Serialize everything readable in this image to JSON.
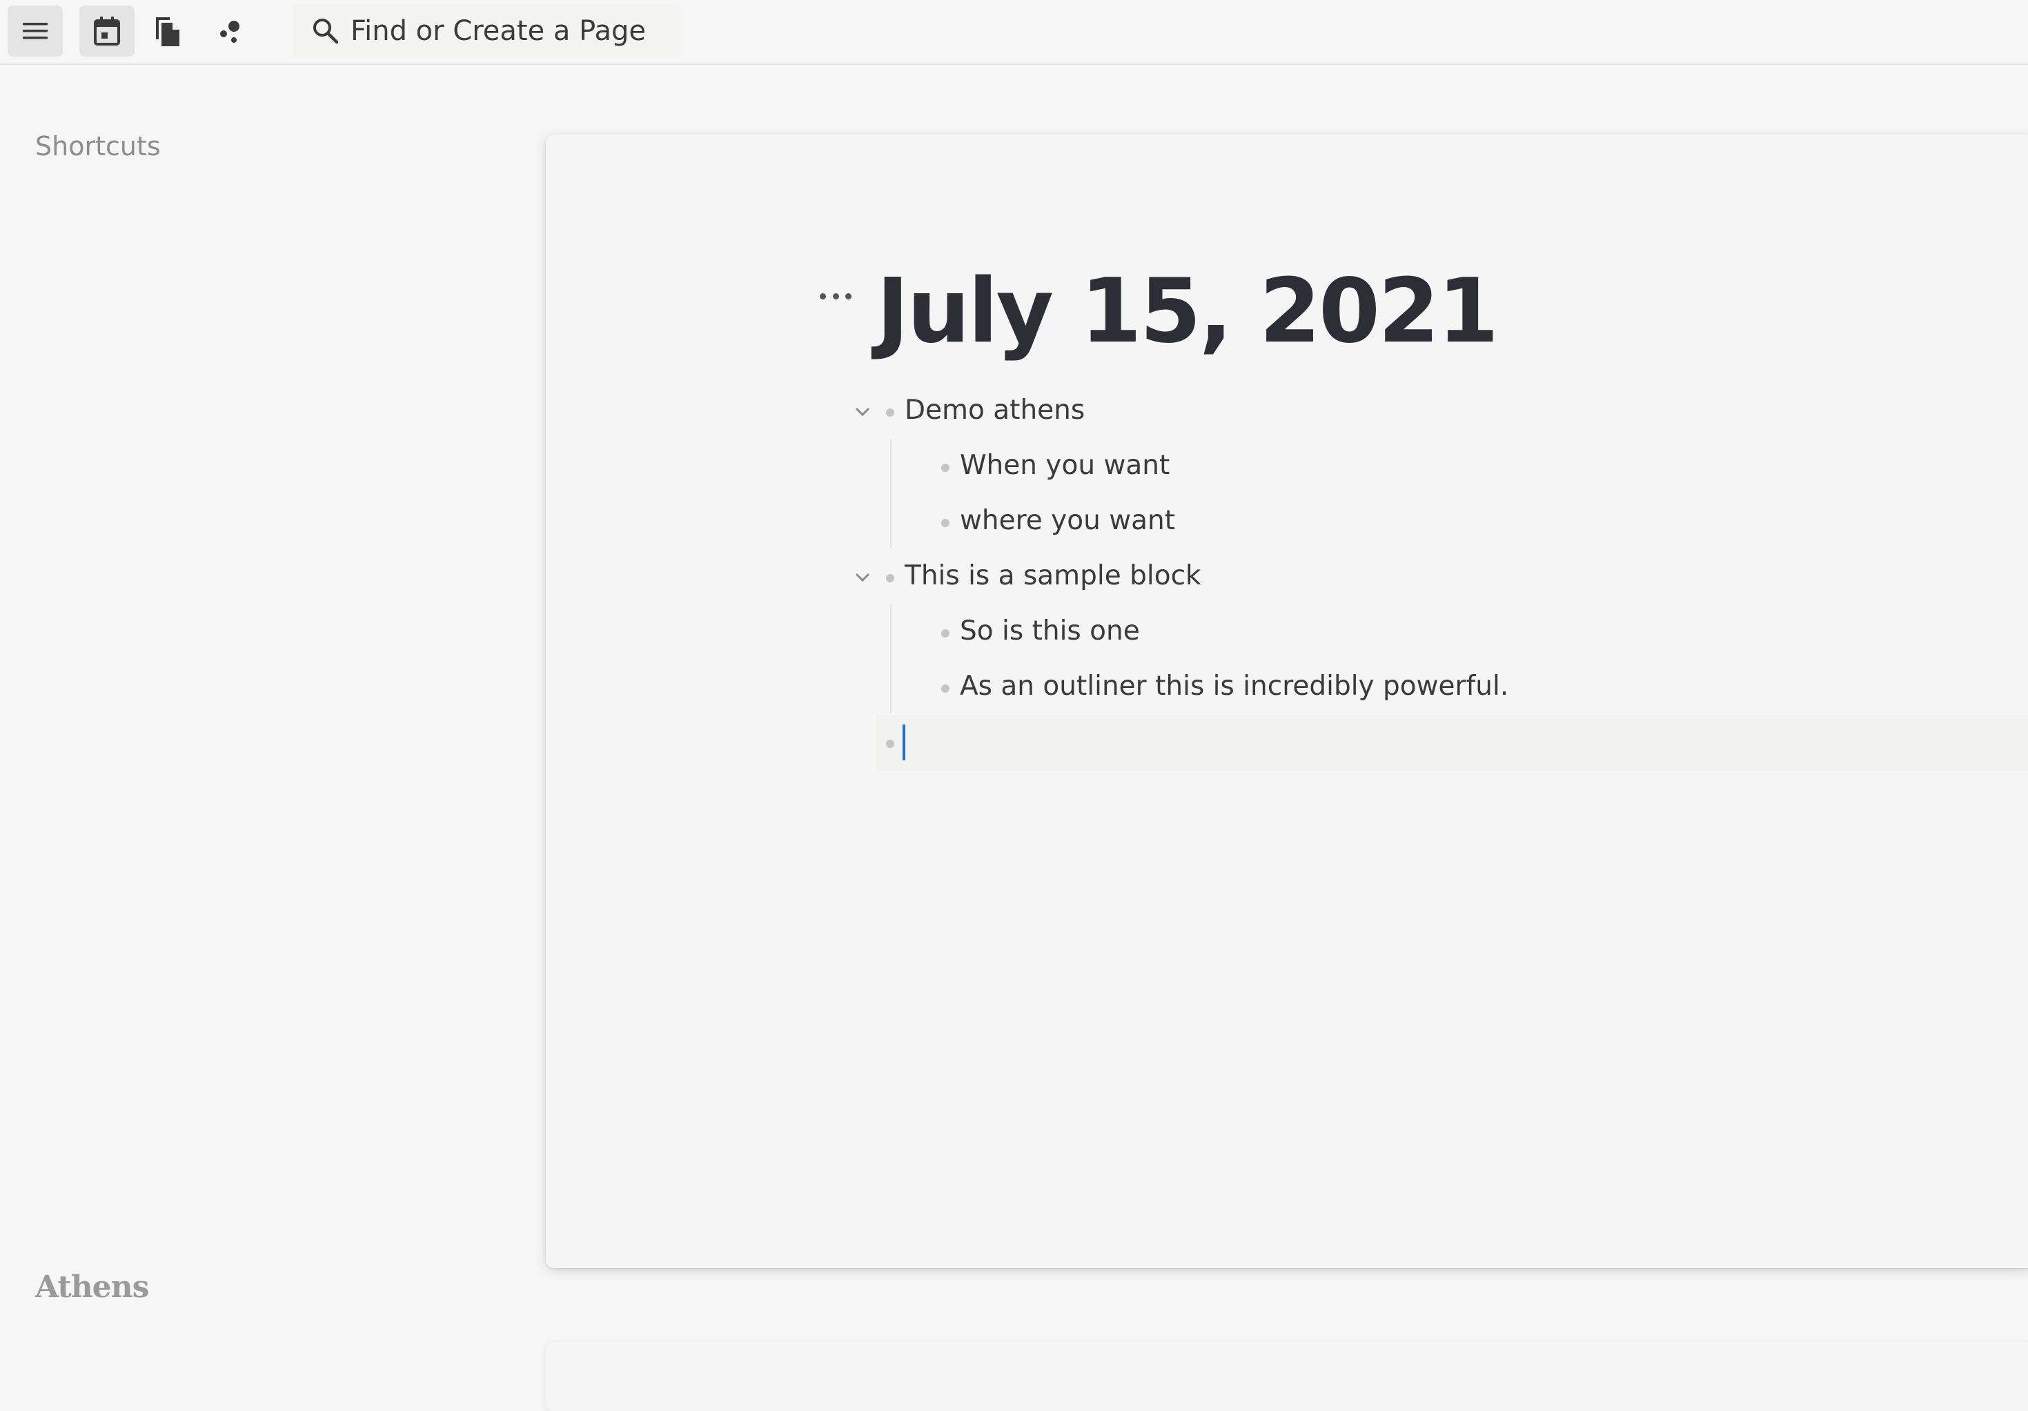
{
  "toolbar": {
    "menu_icon": "hamburger-menu-icon",
    "daily_notes_icon": "calendar-icon",
    "all_pages_icon": "pages-icon",
    "graph_icon": "graph-icon",
    "search": {
      "icon": "search-icon",
      "label": "Find or Create a Page"
    }
  },
  "sidebar": {
    "shortcuts_title": "Shortcuts",
    "logo_text": "Athens"
  },
  "page": {
    "title": "July 15, 2021",
    "blocks": [
      {
        "text": "Demo athens",
        "expanded": true,
        "children": [
          {
            "text": "When you want"
          },
          {
            "text": "where you want"
          }
        ]
      },
      {
        "text": "This is a sample block",
        "expanded": true,
        "children": [
          {
            "text": "So is this one"
          },
          {
            "text": "As an outliner this is incredibly powerful."
          }
        ]
      },
      {
        "text": "",
        "editing": true
      }
    ]
  },
  "colors": {
    "background": "#f6f6f6",
    "title": "#2d2d36",
    "caret": "#1f6fd1",
    "bullet": "#c5c5c5"
  }
}
